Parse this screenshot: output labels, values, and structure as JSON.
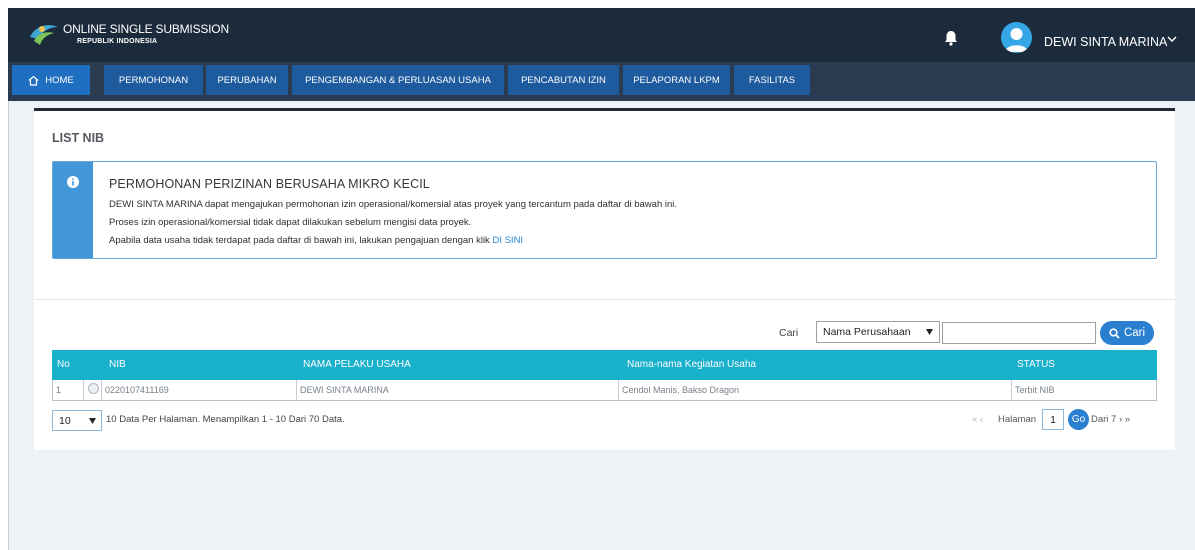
{
  "header": {
    "brand_title": "ONLINE SINGLE SUBMISSION",
    "brand_subtitle": "REPUBLIK INDONESIA",
    "user_name": "DEWI SINTA MARINA",
    "icons": {
      "logo": "oss-logo",
      "bell": "bell-icon",
      "avatar": "avatar",
      "menu": "chevron-down-icon"
    }
  },
  "nav": {
    "items": [
      {
        "label": "HOME",
        "icon": "home-icon"
      },
      {
        "label": "PERMOHONAN"
      },
      {
        "label": "PERUBAHAN"
      },
      {
        "label": "PENGEMBANGAN & PERLUASAN USAHA"
      },
      {
        "label": "PENCABUTAN IZIN"
      },
      {
        "label": "PELAPORAN LKPM"
      },
      {
        "label": "FASILITAS"
      }
    ]
  },
  "main": {
    "title": "LIST NIB",
    "info": {
      "icon": "info-icon",
      "heading": "PERMOHONAN PERIZINAN BERUSAHA MIKRO KECIL",
      "line1": "DEWI SINTA MARINA dapat mengajukan permohonan izin operasional/komersial atas proyek yang tercantum pada daftar di bawah ini.",
      "line2": "Proses izin operasional/komersial tidak dapat dilakukan sebelum mengisi data proyek.",
      "line3_prefix": "Apabila data usaha tidak terdapat pada daftar di bawah ini, lakukan pengajuan dengan klik ",
      "line3_link": "DI SINI"
    },
    "search": {
      "label": "Cari",
      "field_selected": "Nama Perusahaan",
      "input_value": "",
      "button_label": "Cari",
      "button_icon": "search-icon"
    },
    "table": {
      "columns": [
        "No",
        "NIB",
        "NAMA PELAKU USAHA",
        "Nama-nama Kegiatan Usaha",
        "STATUS"
      ],
      "rows": [
        {
          "no": "1",
          "nib": "0220107411169",
          "nama": "DEWI SINTA MARINA",
          "kegiatan": "Cendol Manis, Bakso Dragon",
          "status": "Terbit NIB"
        }
      ]
    },
    "pager": {
      "per_page": "10",
      "info": "10 Data Per Halaman. Menampilkan 1 - 10 Dari 70 Data.",
      "prev": "« ‹",
      "page_label": "Halaman",
      "page_value": "1",
      "go_label": "Go",
      "total": "Dari 7 › »"
    }
  },
  "colors": {
    "header_bg": "#1c2b3b",
    "nav_bg": "#2c3c50",
    "nav_item_bg": "#1e5b9e",
    "table_header": "#19b0cc",
    "accent": "#2a7fd0",
    "info_side": "#4297d8"
  }
}
